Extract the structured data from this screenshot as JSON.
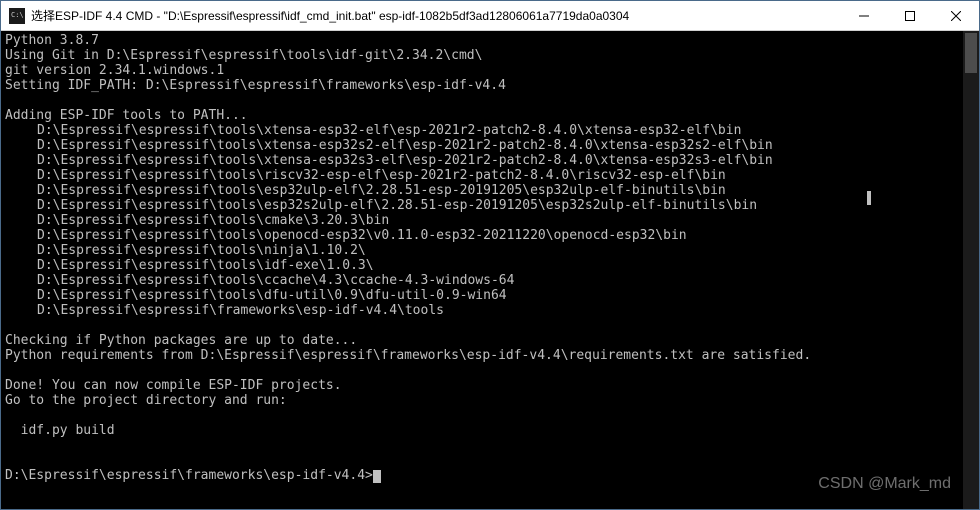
{
  "window": {
    "title": "选择ESP-IDF 4.4 CMD - \"D:\\Espressif\\espressif\\idf_cmd_init.bat\"  esp-idf-1082b5df3ad12806061a7719da0a0304"
  },
  "terminal": {
    "line_python": "Python 3.8.7",
    "line_git": "Using Git in D:\\Espressif\\espressif\\tools\\idf-git\\2.34.2\\cmd\\",
    "line_gitver": "git version 2.34.1.windows.1",
    "line_idfpath": "Setting IDF_PATH: D:\\Espressif\\espressif\\frameworks\\esp-idf-v4.4",
    "line_adding": "Adding ESP-IDF tools to PATH...",
    "paths": [
      "D:\\Espressif\\espressif\\tools\\xtensa-esp32-elf\\esp-2021r2-patch2-8.4.0\\xtensa-esp32-elf\\bin",
      "D:\\Espressif\\espressif\\tools\\xtensa-esp32s2-elf\\esp-2021r2-patch2-8.4.0\\xtensa-esp32s2-elf\\bin",
      "D:\\Espressif\\espressif\\tools\\xtensa-esp32s3-elf\\esp-2021r2-patch2-8.4.0\\xtensa-esp32s3-elf\\bin",
      "D:\\Espressif\\espressif\\tools\\riscv32-esp-elf\\esp-2021r2-patch2-8.4.0\\riscv32-esp-elf\\bin",
      "D:\\Espressif\\espressif\\tools\\esp32ulp-elf\\2.28.51-esp-20191205\\esp32ulp-elf-binutils\\bin",
      "D:\\Espressif\\espressif\\tools\\esp32s2ulp-elf\\2.28.51-esp-20191205\\esp32s2ulp-elf-binutils\\bin",
      "D:\\Espressif\\espressif\\tools\\cmake\\3.20.3\\bin",
      "D:\\Espressif\\espressif\\tools\\openocd-esp32\\v0.11.0-esp32-20211220\\openocd-esp32\\bin",
      "D:\\Espressif\\espressif\\tools\\ninja\\1.10.2\\",
      "D:\\Espressif\\espressif\\tools\\idf-exe\\1.0.3\\",
      "D:\\Espressif\\espressif\\tools\\ccache\\4.3\\ccache-4.3-windows-64",
      "D:\\Espressif\\espressif\\tools\\dfu-util\\0.9\\dfu-util-0.9-win64",
      "D:\\Espressif\\espressif\\frameworks\\esp-idf-v4.4\\tools"
    ],
    "line_checking": "Checking if Python packages are up to date...",
    "line_requirements": "Python requirements from D:\\Espressif\\espressif\\frameworks\\esp-idf-v4.4\\requirements.txt are satisfied.",
    "line_done": "Done! You can now compile ESP-IDF projects.",
    "line_goto": "Go to the project directory and run:",
    "line_idfpy": "  idf.py build",
    "prompt": "D:\\Espressif\\espressif\\frameworks\\esp-idf-v4.4>"
  },
  "watermark": "CSDN @Mark_md"
}
